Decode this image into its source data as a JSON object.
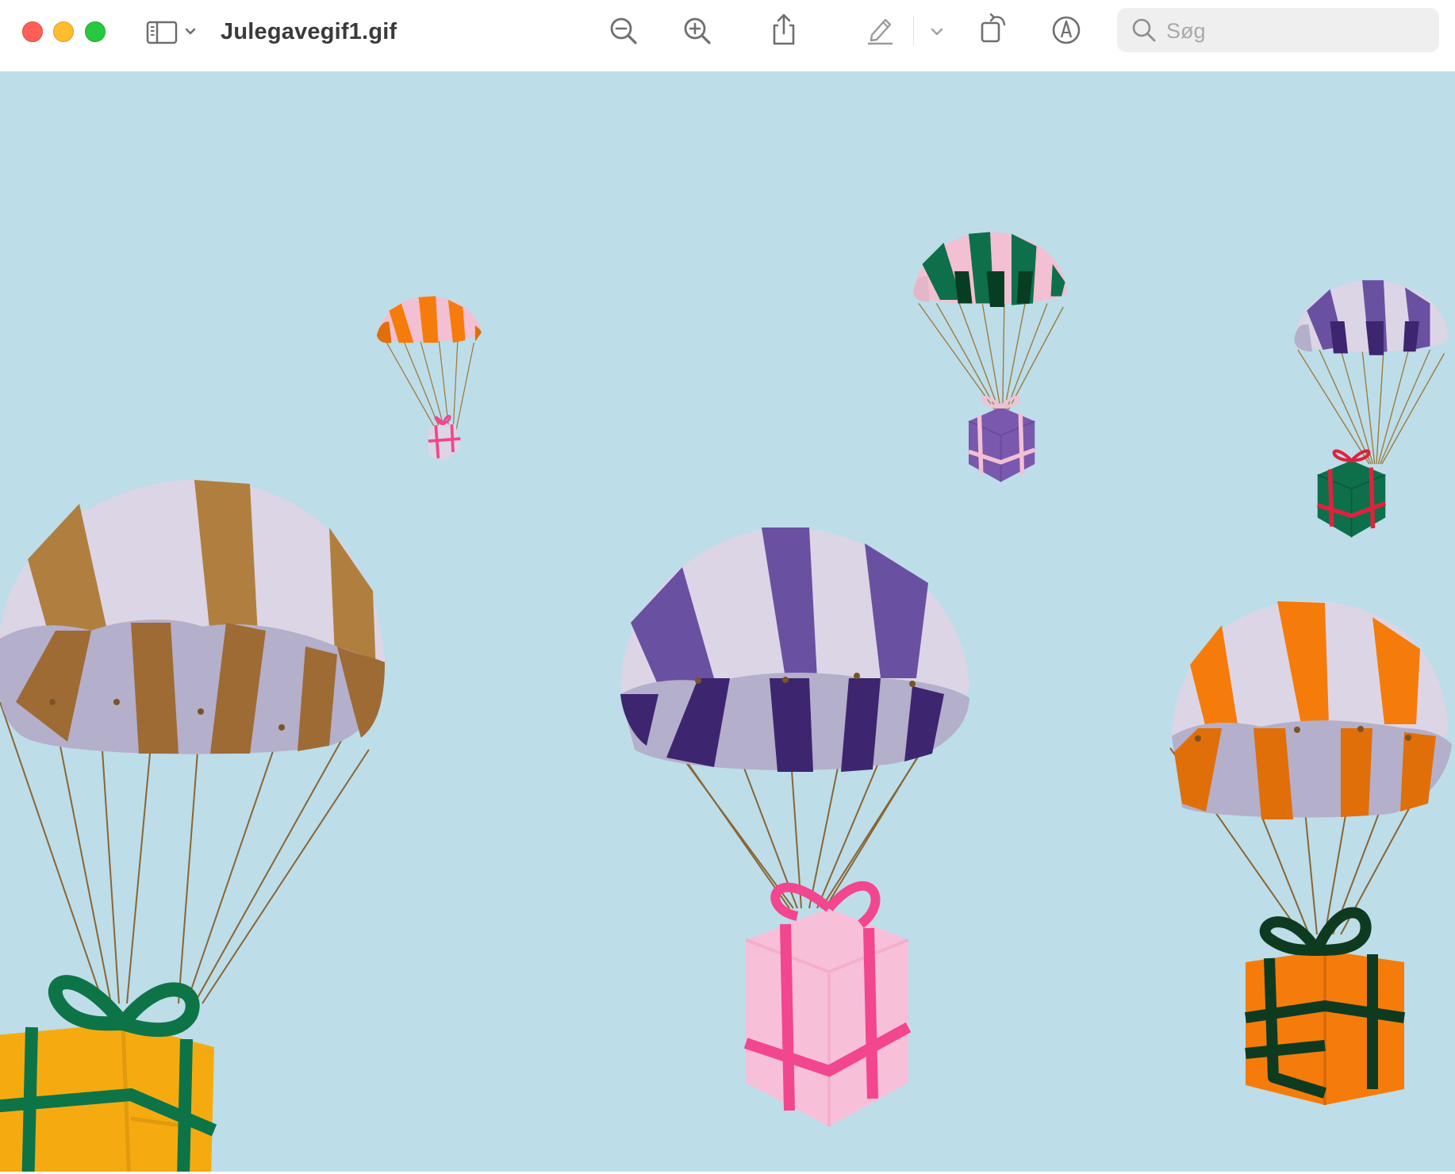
{
  "window": {
    "title": "Julegavegif1.gif"
  },
  "toolbar": {
    "buttons": [
      {
        "name": "sidebar-toggle",
        "icon": "sidebar-icon"
      },
      {
        "name": "zoom-out",
        "icon": "zoom-out-icon"
      },
      {
        "name": "zoom-in",
        "icon": "zoom-in-icon"
      },
      {
        "name": "share",
        "icon": "share-icon"
      },
      {
        "name": "highlight",
        "icon": "highlighter-icon"
      },
      {
        "name": "highlight-options",
        "icon": "chevron-down-icon"
      },
      {
        "name": "rotate",
        "icon": "rotate-icon"
      },
      {
        "name": "markup",
        "icon": "markup-pen-icon"
      }
    ]
  },
  "search": {
    "placeholder": "Søg",
    "value": ""
  },
  "image": {
    "background_color": "#bddde9",
    "parachutes": [
      {
        "name": "tiny-orange-parachute-pink-gift",
        "canopy": [
          "#f57c0b",
          "#f3bfd2"
        ],
        "gift": "#dcd5e6",
        "ribbon": "#f2468f"
      },
      {
        "name": "green-parachute-purple-gift",
        "canopy": [
          "#0d704a",
          "#f3bfd2"
        ],
        "gift": "#7a58ad",
        "ribbon": "#f3bfd2"
      },
      {
        "name": "purple-parachute-green-gift",
        "canopy": [
          "#6a50a1",
          "#dcd5e6"
        ],
        "gift": "#0d704a",
        "ribbon": "#e0213e"
      },
      {
        "name": "brown-parachute-yellow-gift",
        "canopy": [
          "#b07f3f",
          "#dcd5e6"
        ],
        "gift": "#f5ab10",
        "ribbon": "#0d7448"
      },
      {
        "name": "purple-parachute-pink-gift",
        "canopy": [
          "#6a50a1",
          "#dcd5e6"
        ],
        "gift": "#f8bfd8",
        "ribbon": "#f2468f"
      },
      {
        "name": "orange-parachute-orange-gift",
        "canopy": [
          "#f57c0b",
          "#dcd5e6"
        ],
        "gift": "#f57c0b",
        "ribbon": "#0e3b20"
      }
    ]
  }
}
